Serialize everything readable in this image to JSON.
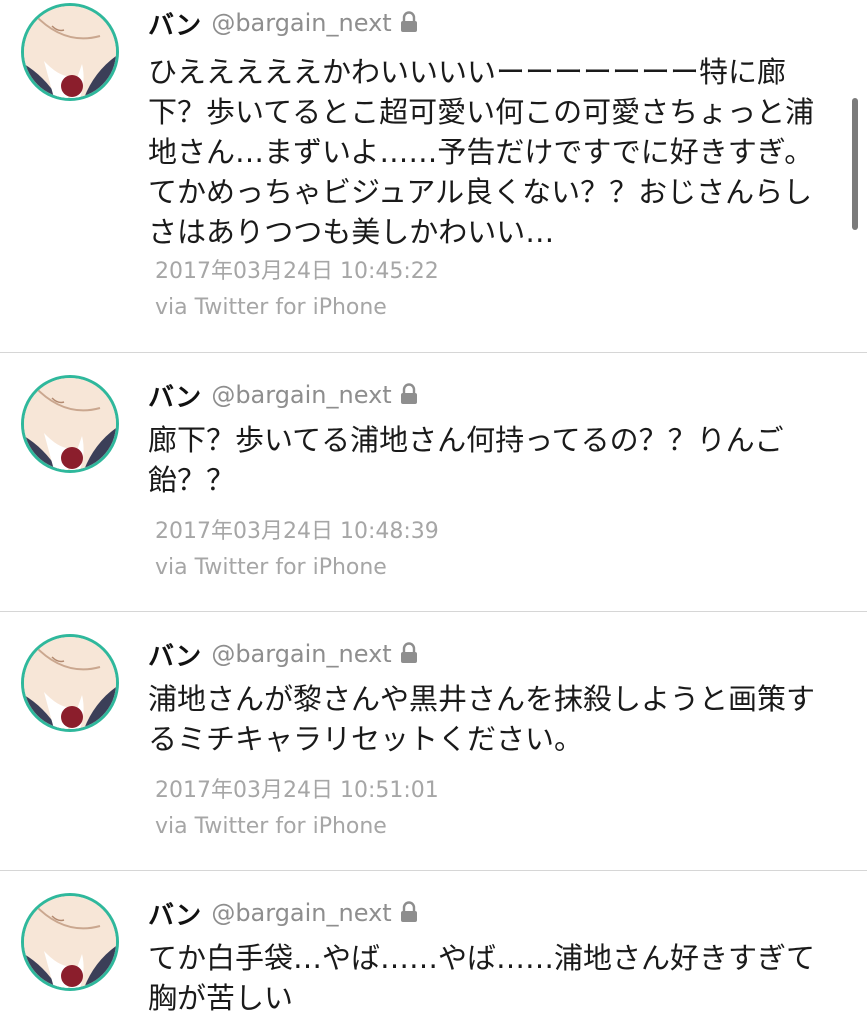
{
  "tweets": [
    {
      "display_name": "バン",
      "handle": "@bargain_next",
      "text": "ひえええええかわいいいいーーーーーーー特に廊下？歩いてるとこ超可愛い何この可愛さちょっと浦地さん…まずいよ……予告だけですでに好きすぎ。てかめっちゃビジュアル良くない？？おじさんらしさはありつつも美しかわいい…",
      "timestamp": "2017年03月24日 10:45:22",
      "source": "via Twitter for iPhone"
    },
    {
      "display_name": "バン",
      "handle": "@bargain_next",
      "text": "廊下？歩いてる浦地さん何持ってるの？？りんご飴？？",
      "timestamp": "2017年03月24日 10:48:39",
      "source": "via Twitter for iPhone"
    },
    {
      "display_name": "バン",
      "handle": "@bargain_next",
      "text": "浦地さんが黎さんや黒井さんを抹殺しようと画策するミチキャラリセットください。",
      "timestamp": "2017年03月24日 10:51:01",
      "source": "via Twitter for iPhone"
    },
    {
      "display_name": "バン",
      "handle": "@bargain_next",
      "text": "てか白手袋…やば……やば……浦地さん好きすぎて胸が苦しい",
      "timestamp": "",
      "source": ""
    }
  ],
  "colors": {
    "avatar_ring": "#2fb89c",
    "handle": "#8e8e8e",
    "meta": "#a6a6a6",
    "divider": "#d6d6d6"
  },
  "icons": {
    "lock": "lock-icon",
    "avatar": "avatar"
  }
}
